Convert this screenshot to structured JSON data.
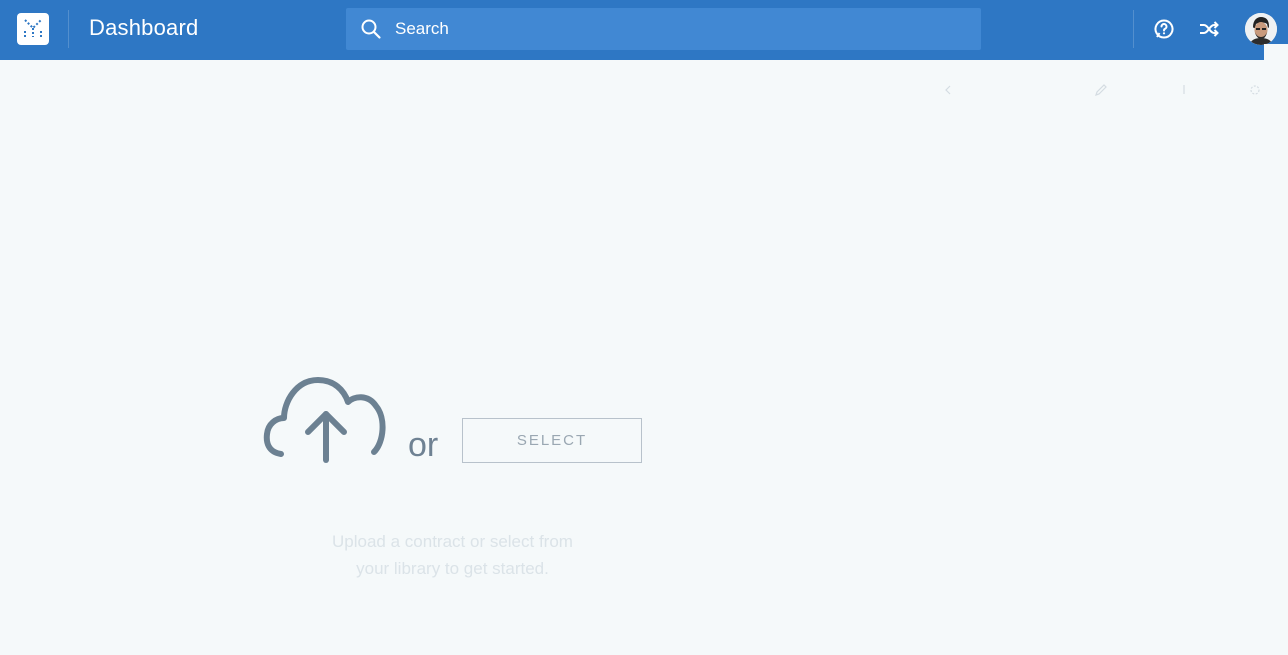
{
  "header": {
    "title": "Dashboard",
    "logo_icon": "logo-icon",
    "accent_color": "#2e77c4"
  },
  "search": {
    "placeholder": "Search",
    "value": "",
    "icon": "search-icon"
  },
  "top_actions": [
    {
      "name": "help-icon"
    },
    {
      "name": "shuffle-icon"
    },
    {
      "name": "avatar"
    }
  ],
  "toolbar": [
    {
      "name": "back-icon"
    },
    {
      "name": "edit-icon"
    },
    {
      "name": "info-icon"
    },
    {
      "name": "settings-icon"
    }
  ],
  "upload": {
    "icon": "cloud-upload-icon",
    "or_text": "or",
    "select_label": "SELECT",
    "hint_line1": "Upload a contract or select from",
    "hint_line2": "your library to get started."
  }
}
